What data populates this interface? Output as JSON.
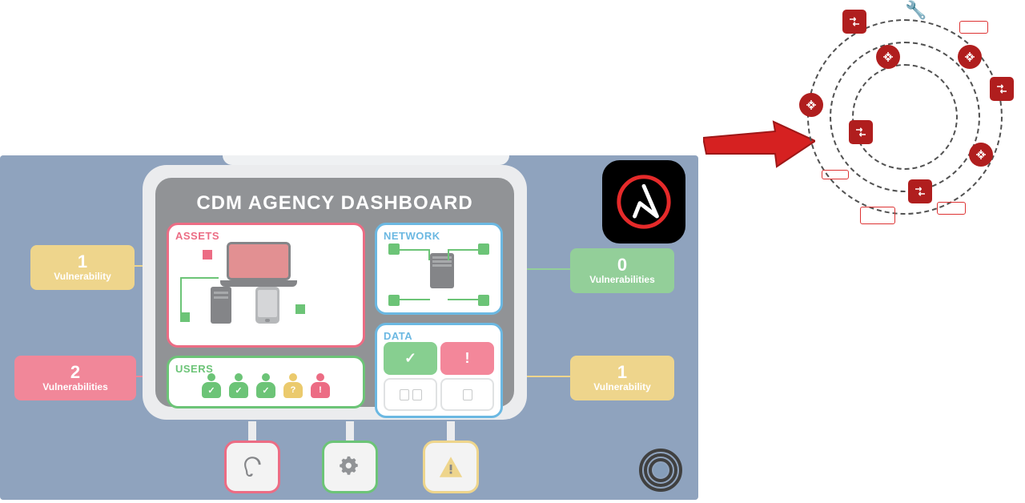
{
  "dashboard": {
    "title": "CDM AGENCY DASHBOARD",
    "assets": {
      "label": "ASSETS"
    },
    "users": {
      "label": "USERS",
      "states": [
        "ok",
        "ok",
        "ok",
        "warn",
        "alert"
      ]
    },
    "network": {
      "label": "NETWORK"
    },
    "data": {
      "label": "DATA",
      "ok_glyph": "✓",
      "alert_glyph": "!"
    }
  },
  "badges": {
    "left_top": {
      "count": "1",
      "label": "Vulnerability",
      "color": "yellow"
    },
    "left_bottom": {
      "count": "2",
      "label": "Vulnerabilities",
      "color": "red"
    },
    "right_top": {
      "count": "0",
      "label": "Vulnerabilities",
      "color": "green"
    },
    "right_bottom": {
      "count": "1",
      "label": "Vulnerability",
      "color": "yellow"
    }
  },
  "bottom_icons": [
    "audio-icon",
    "gears-icon",
    "warning-icon"
  ],
  "ansible": {
    "name": "Ansible"
  },
  "arrow": {
    "direction": "right",
    "color": "#d62121"
  },
  "ring": {
    "orbits": 3,
    "nodes": [
      {
        "shape": "square",
        "kind": "switch"
      },
      {
        "shape": "wrench",
        "kind": "tool"
      },
      {
        "shape": "outline",
        "kind": "rack"
      },
      {
        "shape": "circle",
        "kind": "router"
      },
      {
        "shape": "square",
        "kind": "switch"
      },
      {
        "shape": "circle",
        "kind": "router"
      },
      {
        "shape": "square",
        "kind": "switch"
      },
      {
        "shape": "outline",
        "kind": "rack"
      },
      {
        "shape": "outline",
        "kind": "server"
      },
      {
        "shape": "circle",
        "kind": "router"
      },
      {
        "shape": "outline",
        "kind": "blade"
      },
      {
        "shape": "square",
        "kind": "switch"
      },
      {
        "shape": "circle",
        "kind": "hub"
      }
    ]
  }
}
